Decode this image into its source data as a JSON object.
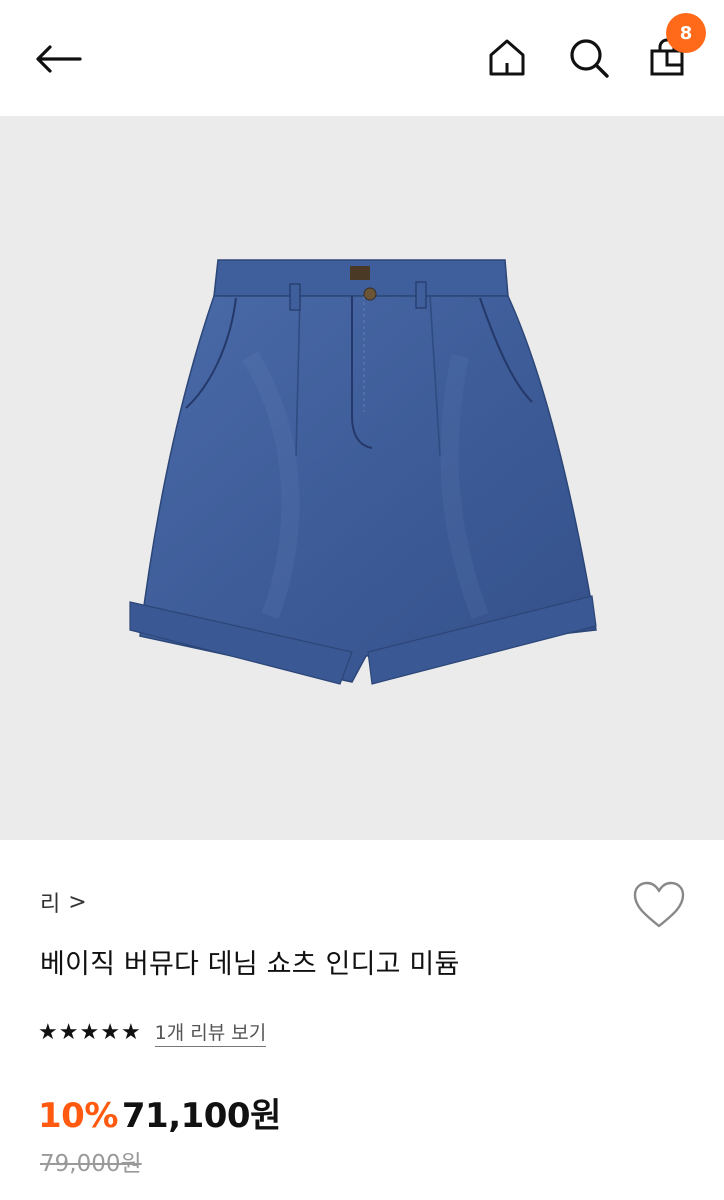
{
  "header": {
    "back_icon": "arrow-left-icon",
    "home_icon": "home-icon",
    "search_icon": "search-icon",
    "bag_icon": "shopping-bag-icon",
    "cart_count": "8",
    "badge_color": "#ff6a1a"
  },
  "product": {
    "image_alt_icon": "denim-shorts-image",
    "brand": "리",
    "brand_chevron": ">",
    "wishlist_icon": "heart-icon",
    "title": "베이직 버뮤다 데님 쇼츠 인디고 미듐",
    "rating": {
      "stars": 5,
      "review_text": "1개 리뷰 보기"
    },
    "price": {
      "discount": "10%",
      "sale_price": "71,100원",
      "original_price": "79,000원",
      "discount_color": "#ff5a0f"
    }
  },
  "colors": {
    "hero_background": "#ebebeb",
    "denim": "#3e5f9c"
  }
}
